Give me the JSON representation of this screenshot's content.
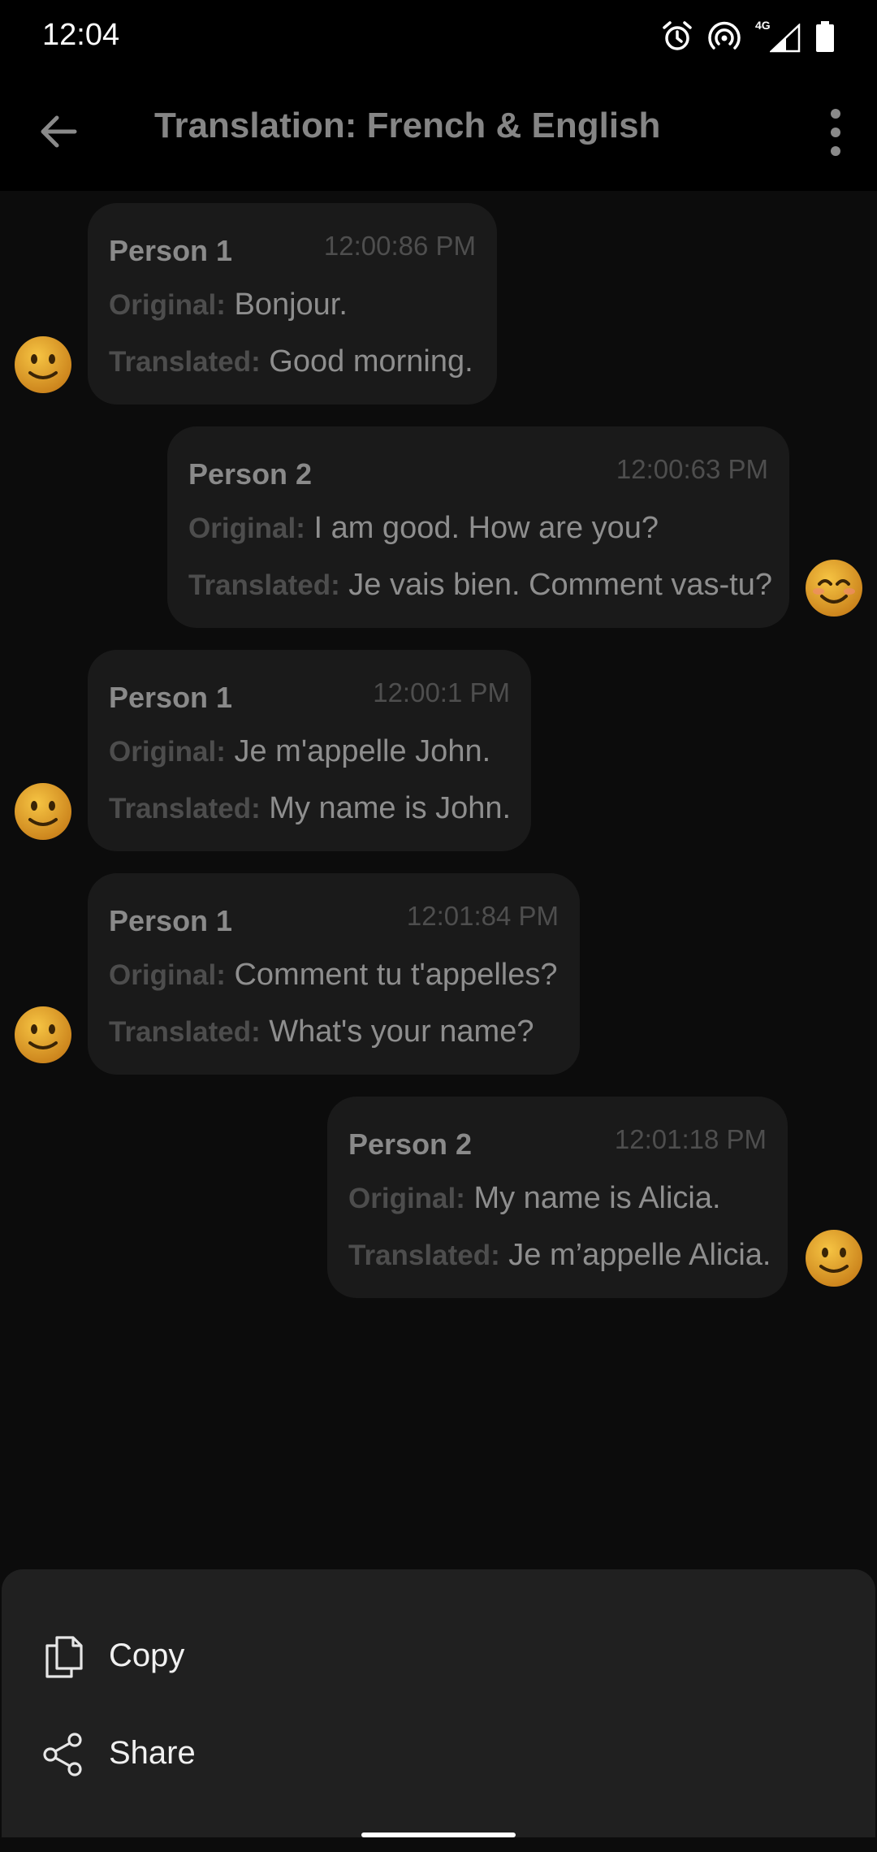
{
  "status_bar": {
    "time": "12:04",
    "network_label": "4G",
    "icons": [
      "alarm-icon",
      "hotspot-icon",
      "signal-icon",
      "battery-icon"
    ]
  },
  "app_bar": {
    "title": "Translation: French & English",
    "icons": [
      "back-arrow-icon",
      "more-vert-icon"
    ]
  },
  "labels": {
    "original": "Original:",
    "translated": "Translated:"
  },
  "messages": [
    {
      "sender": "Person 1",
      "time": "12:00:86 PM",
      "original": "Bonjour.",
      "translated": "Good morning.",
      "side": "left",
      "emoji": "slightly-smiling-face"
    },
    {
      "sender": "Person 2",
      "time": "12:00:63 PM",
      "original": "I am good. How are you?",
      "translated": "Je vais bien. Comment vas-tu?",
      "side": "right",
      "emoji": "smiling-face-with-smiling-eyes"
    },
    {
      "sender": "Person 1",
      "time": "12:00:1 PM",
      "original": "Je m'appelle John.",
      "translated": "My name is John.",
      "side": "left",
      "emoji": "slightly-smiling-face"
    },
    {
      "sender": "Person 1",
      "time": "12:01:84 PM",
      "original": "Comment tu t'appelles?",
      "translated": "What's your name?",
      "side": "left",
      "emoji": "slightly-smiling-face"
    },
    {
      "sender": "Person 2",
      "time": "12:01:18 PM",
      "original": "My name is Alicia.",
      "translated": "Je m’appelle Alicia.",
      "side": "right",
      "emoji": "slightly-smiling-face"
    }
  ],
  "bottom_sheet": {
    "items": [
      {
        "label": "Copy",
        "icon": "copy-icon"
      },
      {
        "label": "Share",
        "icon": "share-icon"
      }
    ]
  },
  "colors": {
    "background": "#0c0c0c",
    "bubble": "#1a1a1a",
    "sheet": "#202020",
    "emoji_yellow": "#e8a424"
  }
}
